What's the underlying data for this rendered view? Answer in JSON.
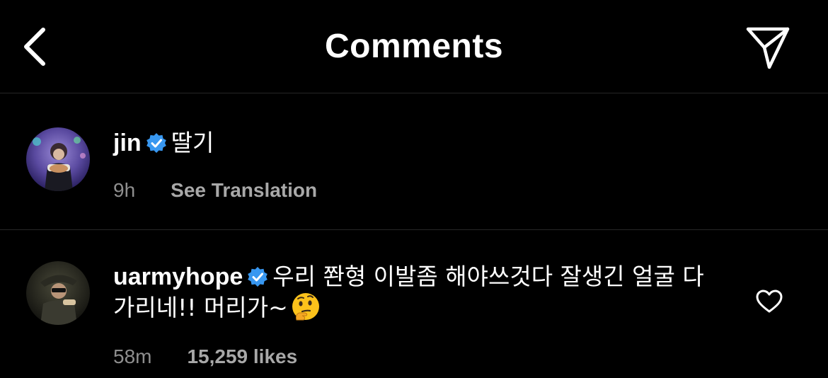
{
  "header": {
    "title": "Comments",
    "back_icon": "chevron-left-icon",
    "share_icon": "paper-plane-icon"
  },
  "colors": {
    "background": "#000000",
    "text": "#ffffff",
    "meta": "#a8a8a8",
    "divider": "#262626",
    "verified": "#3897f0"
  },
  "comments": [
    {
      "username": "jin",
      "verified": true,
      "text": "딸기",
      "time": "9h",
      "action": "See Translation"
    },
    {
      "username": "uarmyhope",
      "verified": true,
      "text": "우리 쫜형 이발좀 해야쓰것다 잘생긴 얼굴 다 가리네!! 머리가~",
      "emoji": "thinking-face-emoji",
      "time": "58m",
      "likes": "15,259 likes",
      "like_icon": "heart-outline-icon"
    }
  ]
}
